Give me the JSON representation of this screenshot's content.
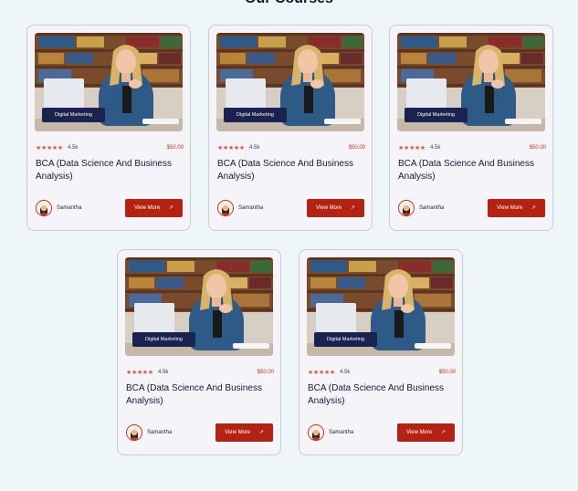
{
  "section": {
    "title": "Our Courses"
  },
  "icons": {
    "star": "star-icon",
    "arrow": "arrow-up-right-icon",
    "avatar": "avatar-icon"
  },
  "colors": {
    "accent": "#b42312",
    "tag_bg": "#1b2250",
    "star": "#e5523b",
    "page_bg": "#eef6fa"
  },
  "courses": [
    {
      "tag": "Digital Marketing",
      "stars": "★★★★★",
      "rating": "4.5k",
      "price": "$50.00",
      "title": "BCA (Data Science And Business Analysis)",
      "author": "Samantha",
      "button": "View More",
      "arrow": "↗"
    },
    {
      "tag": "Digital Marketing",
      "stars": "★★★★★",
      "rating": "4.5k",
      "price": "$50.00",
      "title": "BCA (Data Science And Business Analysis)",
      "author": "Samantha",
      "button": "View More",
      "arrow": "↗"
    },
    {
      "tag": "Digital Marketing",
      "stars": "★★★★★",
      "rating": "4.5k",
      "price": "$50.00",
      "title": "BCA (Data Science And Business Analysis)",
      "author": "Samantha",
      "button": "View More",
      "arrow": "↗"
    },
    {
      "tag": "Digital Marketing",
      "stars": "★★★★★",
      "rating": "4.5k",
      "price": "$50.00",
      "title": "BCA (Data Science And Business Analysis)",
      "author": "Samantha",
      "button": "View More",
      "arrow": "↗"
    },
    {
      "tag": "Digital Marketing",
      "stars": "★★★★★",
      "rating": "4.5k",
      "price": "$50.00",
      "title": "BCA (Data Science And Business Analysis)",
      "author": "Samantha",
      "button": "View More",
      "arrow": "↗"
    }
  ]
}
